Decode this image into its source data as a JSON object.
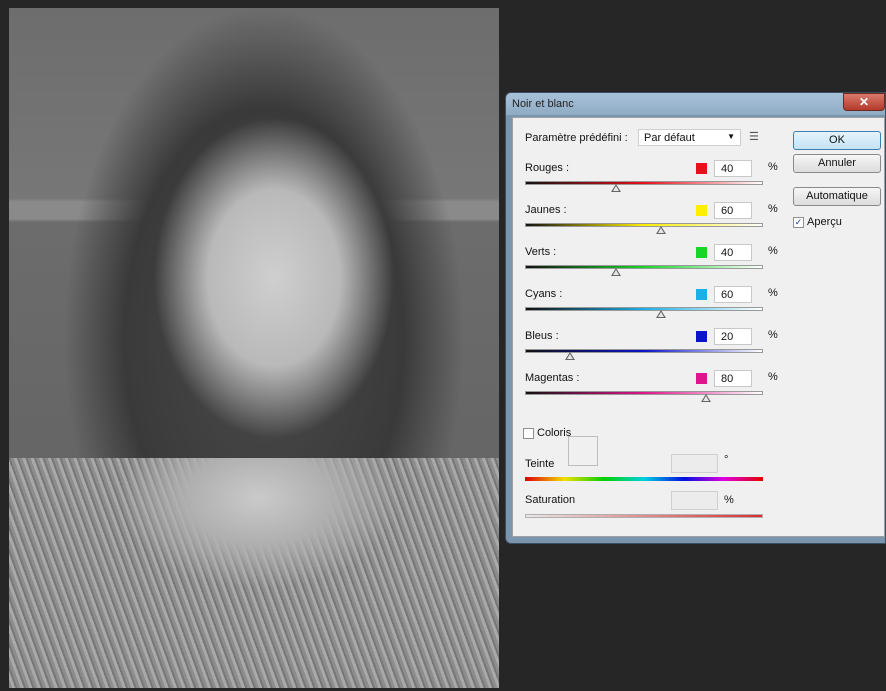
{
  "dialog": {
    "title": "Noir et blanc",
    "close_glyph": "✕",
    "preset_label": "Paramètre prédéfini :",
    "preset_value": "Par défaut",
    "preset_menu_icon": "list-menu-icon",
    "channels": [
      {
        "label": "Rouges :",
        "value": "40",
        "unit": "%",
        "color": "#e8101a",
        "level": 40
      },
      {
        "label": "Jaunes :",
        "value": "60",
        "unit": "%",
        "color": "#ffee00",
        "level": 60
      },
      {
        "label": "Verts :",
        "value": "40",
        "unit": "%",
        "color": "#18d628",
        "level": 40
      },
      {
        "label": "Cyans :",
        "value": "60",
        "unit": "%",
        "color": "#1ab0e6",
        "level": 60
      },
      {
        "label": "Bleus :",
        "value": "20",
        "unit": "%",
        "color": "#0a14c8",
        "level": 20
      },
      {
        "label": "Magentas :",
        "value": "80",
        "unit": "%",
        "color": "#e0148c",
        "level": 80
      }
    ],
    "buttons": {
      "ok": "OK",
      "cancel": "Annuler",
      "auto": "Automatique"
    },
    "preview_label": "Aperçu",
    "preview_checked": true,
    "tint_label": "Coloris",
    "tint_checked": false,
    "hue_label": "Teinte",
    "hue_unit": "°",
    "saturation_label": "Saturation",
    "saturation_unit": "%"
  }
}
